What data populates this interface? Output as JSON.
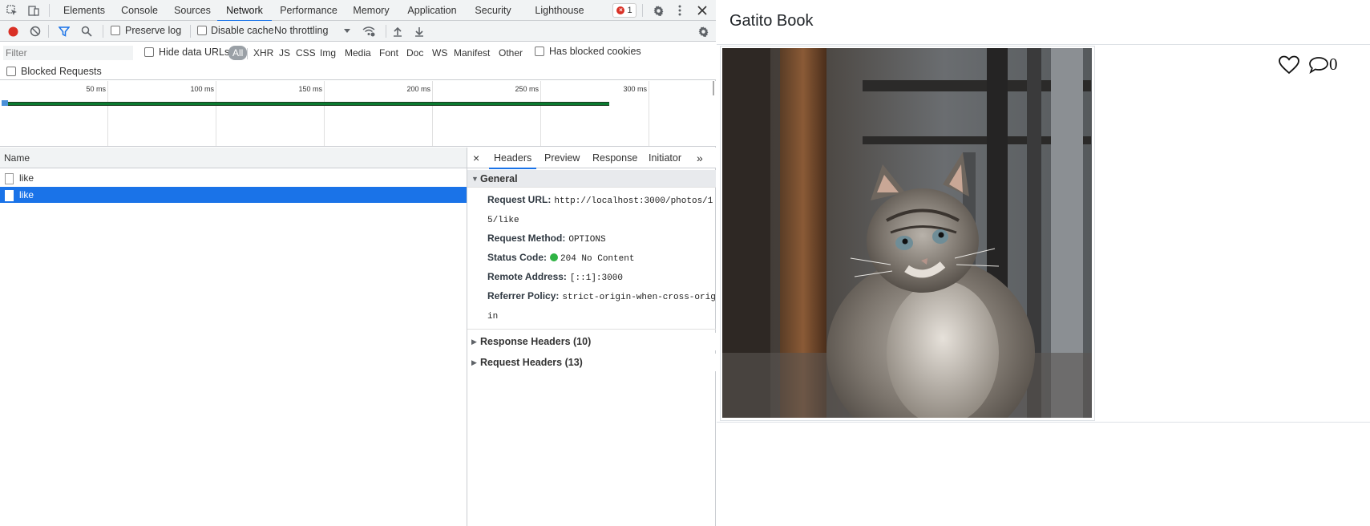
{
  "devtools": {
    "tabs": [
      "Elements",
      "Console",
      "Sources",
      "Network",
      "Performance",
      "Memory",
      "Application",
      "Security",
      "Lighthouse"
    ],
    "active_tab": "Network",
    "error_count": "1",
    "toolbar": {
      "preserve_log": "Preserve log",
      "disable_cache": "Disable cache",
      "throttling": "No throttling"
    },
    "filter": {
      "placeholder": "Filter",
      "hide_data_urls": "Hide data URLs",
      "types": [
        "All",
        "XHR",
        "JS",
        "CSS",
        "Img",
        "Media",
        "Font",
        "Doc",
        "WS",
        "Manifest",
        "Other"
      ],
      "active_type": "All",
      "has_blocked_cookies": "Has blocked cookies",
      "blocked_requests": "Blocked Requests"
    },
    "overview": {
      "ticks": [
        "50 ms",
        "100 ms",
        "150 ms",
        "200 ms",
        "250 ms",
        "300 ms"
      ]
    },
    "requests": {
      "header": "Name",
      "rows": [
        {
          "name": "like",
          "selected": false
        },
        {
          "name": "like",
          "selected": true
        }
      ]
    },
    "details": {
      "close": "×",
      "tabs": [
        "Headers",
        "Preview",
        "Response",
        "Initiator"
      ],
      "more": "»",
      "general": {
        "title": "General",
        "request_url_label": "Request URL:",
        "request_url": "http://localhost:3000/photos/15/like",
        "request_method_label": "Request Method:",
        "request_method": "OPTIONS",
        "status_code_label": "Status Code:",
        "status_code": "204 No Content",
        "remote_address_label": "Remote Address:",
        "remote_address": "[::1]:3000",
        "referrer_policy_label": "Referrer Policy:",
        "referrer_policy": "strict-origin-when-cross-origin"
      },
      "response_headers": "Response Headers (10)",
      "request_headers": "Request Headers (13)"
    }
  },
  "page": {
    "title": "Gatito Book",
    "comment_count": "0"
  }
}
